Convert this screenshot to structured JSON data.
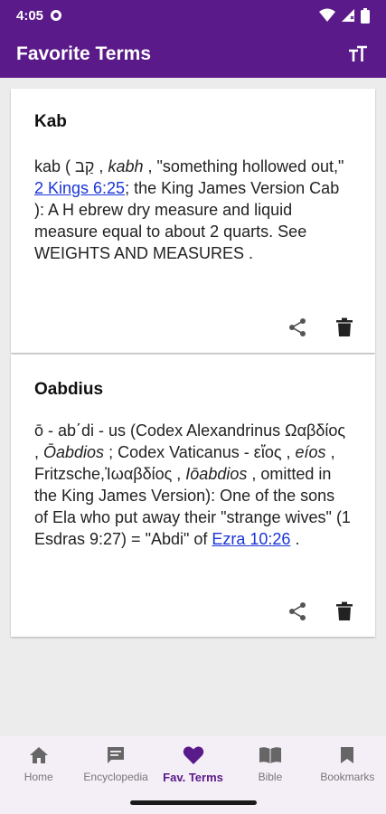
{
  "status": {
    "time": "4:05"
  },
  "app_bar": {
    "title": "Favorite Terms"
  },
  "terms": [
    {
      "title": "Kab",
      "body": {
        "p1": "kab ( ",
        "hebrew": "קַב",
        "p2": " , ",
        "translit": "kabh",
        "p3": " , \"something hollowed out,\" ",
        "link": "2 Kings 6:25",
        "p4": "; the King James Version Cab ): A H ebrew dry measure and liquid measure equal to about 2 quarts. See WEIGHTS AND MEASURES ."
      }
    },
    {
      "title": "Oabdius",
      "body": {
        "p1": "ō - ab΄di - us (Codex Alexandrinus Ωαβδίος , ",
        "i1": "Ōabdios",
        "p2": " ; Codex Vaticanus - εἴος , ",
        "i2": "eíos",
        "p3": " , Fritzsche,Ἰωαβδίος , ",
        "i3": "Iōabdios",
        "p4": " , omitted in the King James Version): One of the sons of Ela who put away their \"strange wives\" (1 Esdras 9:27) = \"Abdi\" of ",
        "link": "Ezra 10:26",
        "p5": " ."
      }
    }
  ],
  "nav": [
    {
      "label": "Home",
      "icon": "home-icon"
    },
    {
      "label": "Encyclopedia",
      "icon": "chat-icon"
    },
    {
      "label": "Fav. Terms",
      "icon": "heart-icon",
      "active": true
    },
    {
      "label": "Bible",
      "icon": "book-icon"
    },
    {
      "label": "Bookmarks",
      "icon": "bookmark-icon"
    }
  ],
  "colors": {
    "primary": "#5a1a8a",
    "link": "#1a35d6",
    "nav_bg": "#f4eef7"
  }
}
